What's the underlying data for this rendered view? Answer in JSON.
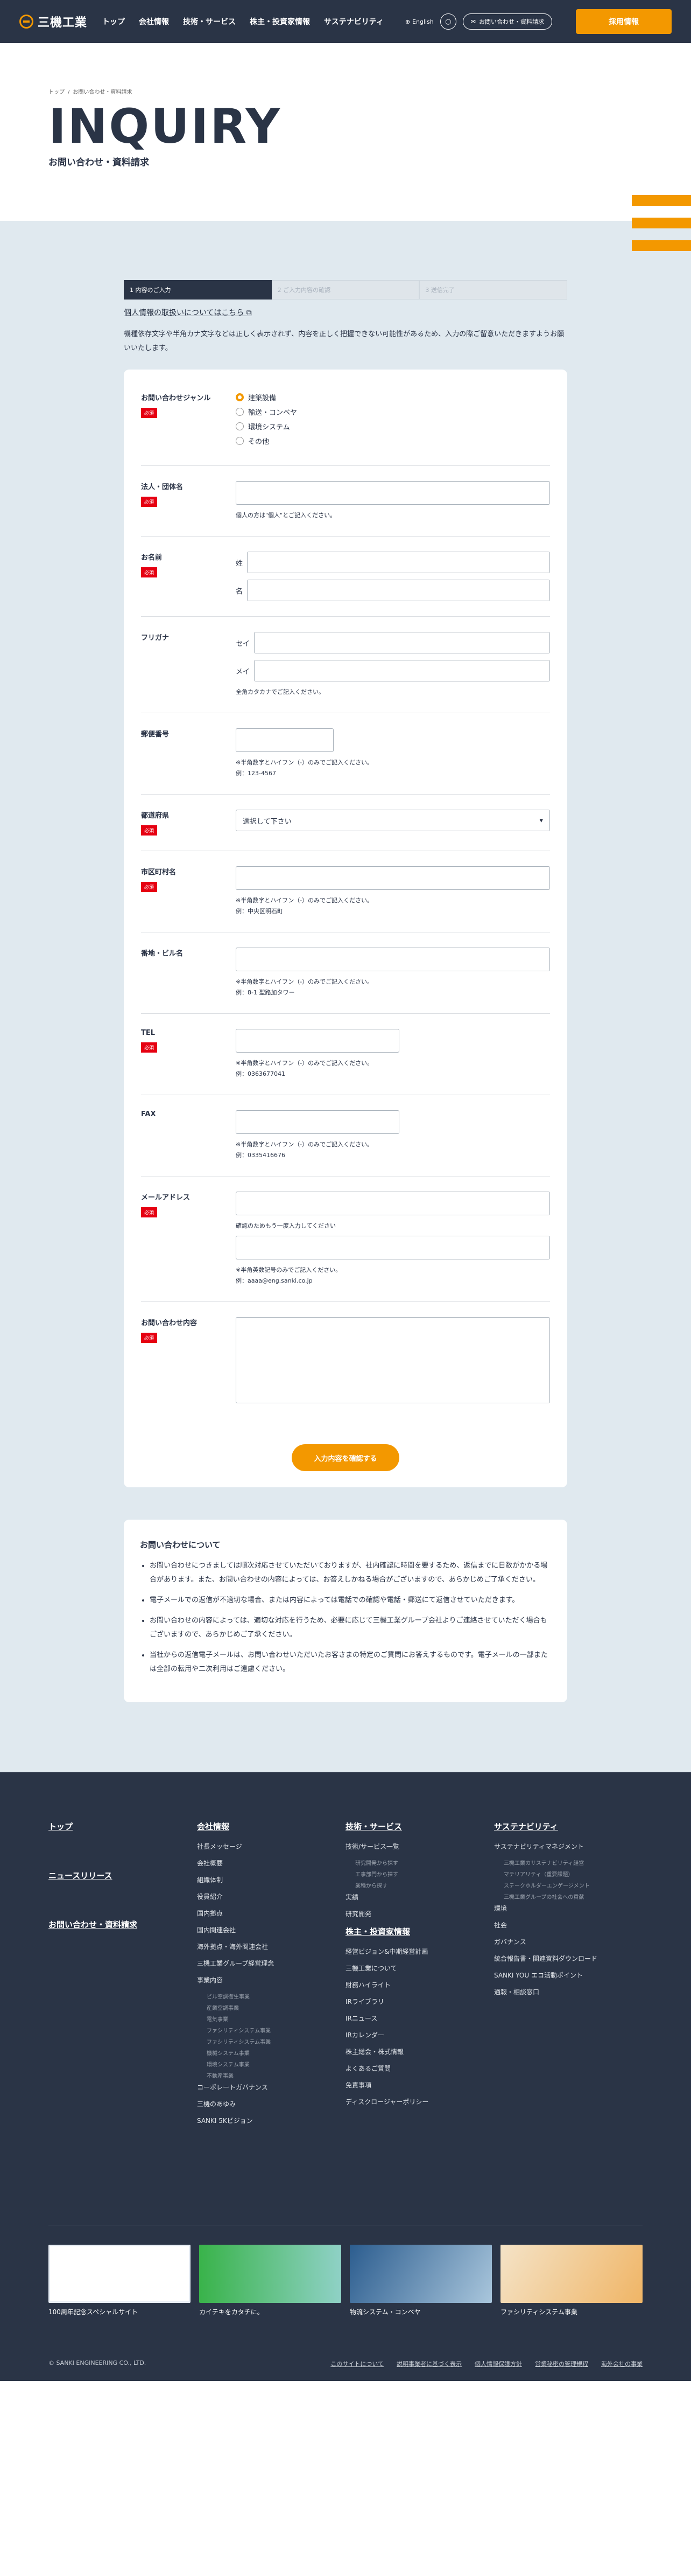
{
  "header": {
    "logo": "三機工業",
    "nav": [
      "トップ",
      "会社情報",
      "技術・サービス",
      "株主・投資家情報",
      "サステナビリティ"
    ],
    "lang": "English",
    "inquiry": "お問い合わせ・資料請求",
    "recruit": "採用情報"
  },
  "hero": {
    "bc": [
      "トップ",
      "お問い合わせ・資料請求"
    ],
    "title": "INQUIRY",
    "subtitle": "お問い合わせ・資料請求"
  },
  "steps": [
    "1 内容のご入力",
    "2 ご入力内容の確認",
    "3 送信完了"
  ],
  "privacy_link": "個人情報の取扱いについてはこちら",
  "intro": "機種依存文字や半角カナ文字などは正しく表示されず、内容を正しく把握できない可能性があるため、入力の際ご留意いただきますようお願いいたします。",
  "req": "必須",
  "f": {
    "genre": {
      "label": "お問い合わせジャンル",
      "opts": [
        "建築設備",
        "輸送・コンベヤ",
        "環境システム",
        "その他"
      ]
    },
    "corp": {
      "label": "法人・団体名",
      "note": "個人の方は\"個人\"とご記入ください。"
    },
    "name": {
      "label": "お名前",
      "sei": "姓",
      "mei": "名"
    },
    "kana": {
      "label": "フリガナ",
      "sei": "セイ",
      "mei": "メイ",
      "note": "全角カタカナでご記入ください。"
    },
    "zip": {
      "label": "郵便番号",
      "note": "※半角数字とハイフン（-）のみでご記入ください。",
      "ex": "例：123-4567"
    },
    "pref": {
      "label": "都道府県",
      "sel": "選択して下さい"
    },
    "city": {
      "label": "市区町村名",
      "note": "※半角数字とハイフン（-）のみでご記入ください。",
      "ex": "例：中央区明石町"
    },
    "addr": {
      "label": "番地・ビル名",
      "note": "※半角数字とハイフン（-）のみでご記入ください。",
      "ex": "例：8-1 聖路加タワー"
    },
    "tel": {
      "label": "TEL",
      "note": "※半角数字とハイフン（-）のみでご記入ください。",
      "ex": "例：0363677041"
    },
    "fax": {
      "label": "FAX",
      "note": "※半角数字とハイフン（-）のみでご記入ください。",
      "ex": "例：0335416676"
    },
    "mail": {
      "label": "メールアドレス",
      "confirm": "確認のためもう一度入力してください",
      "note": "※半角英数記号のみでご記入ください。",
      "ex": "例：aaaa@eng.sanki.co.jp"
    },
    "content": {
      "label": "お問い合わせ内容"
    }
  },
  "confirm_btn": "入力内容を確認する",
  "about": {
    "title": "お問い合わせについて",
    "items": [
      "お問い合わせにつきましては順次対応させていただいておりますが、社内確認に時間を要するため、返信までに日数がかかる場合があります。また、お問い合わせの内容によっては、お答えしかねる場合がございますので、あらかじめご了承ください。",
      "電子メールでの返信が不適切な場合、または内容によっては電話での確認や電話・郵送にて返信させていただきます。",
      "お問い合わせの内容によっては、適切な対応を行うため、必要に応じて三機工業グループ会社よりご連絡させていただく場合もございますので、あらかじめご了承ください。",
      "当社からの返信電子メールは、お問い合わせいただいたお客さまの特定のご質問にお答えするものです。電子メールの一部または全部の転用や二次利用はご遠慮ください。"
    ]
  },
  "footer": {
    "big": [
      "トップ",
      "ニュースリリース",
      "お問い合わせ・資料請求"
    ],
    "c1": {
      "h": "会社情報",
      "items": [
        "社長メッセージ",
        "会社概要",
        "組織体制",
        "役員紹介",
        "国内拠点",
        "国内関連会社",
        "海外拠点・海外関連会社",
        "三機工業グループ経営理念",
        "事業内容"
      ],
      "sub": [
        "ビル空調衛生事業",
        "産業空調事業",
        "電気事業",
        "ファシリティシステム事業",
        "ファシリティシステム事業",
        "機械システム事業",
        "環境システム事業",
        "不動産事業"
      ],
      "items2": [
        "コーポレートガバナンス",
        "三機のあゆみ",
        "SANKI 5Kビジョン"
      ]
    },
    "c2": {
      "h": "技術・サービス",
      "items": [
        "技術/サービス一覧"
      ],
      "sub": [
        "研究開発から探す",
        "工事部門から探す",
        "業種から探す"
      ],
      "items2": [
        "実績",
        "研究開発"
      ],
      "h2": "株主・投資家情報",
      "items3": [
        "経営ビジョン&中期経営計画",
        "三機工業について",
        "財務ハイライト",
        "IRライブラリ",
        "IRニュース",
        "IRカレンダー",
        "株主総会・株式情報",
        "よくあるご質問",
        "免責事項",
        "ディスクロージャーポリシー"
      ]
    },
    "c3": {
      "h": "サステナビリティ",
      "items": [
        "サステナビリティマネジメント"
      ],
      "sub": [
        "三機工業のサステナビリティ経営",
        "マテリアリティ（重要課題）",
        "ステークホルダーエンゲージメント",
        "三機工業グループの社会への貢献"
      ],
      "items2": [
        "環境",
        "社会",
        "ガバナンス",
        "統合報告書・関連資料ダウンロード",
        "SANKI YOU エコ活動ポイント",
        "通報・相談窓口"
      ]
    },
    "banners": [
      "100周年記念スペシャルサイト",
      "カイテキをカタチに。",
      "物流システム・コンベヤ",
      "ファシリティシステム事業"
    ],
    "copy": "© SANKI ENGINEERING CO., LTD.",
    "links": [
      "このサイトについて",
      "説明事業者に基づく表示",
      "個人情報保護方針",
      "営業秘密の管理規程",
      "海外会社の事業"
    ]
  },
  "colors": {
    "navy": "#2a3446",
    "orange": "#f39800",
    "red": "#e60012"
  }
}
